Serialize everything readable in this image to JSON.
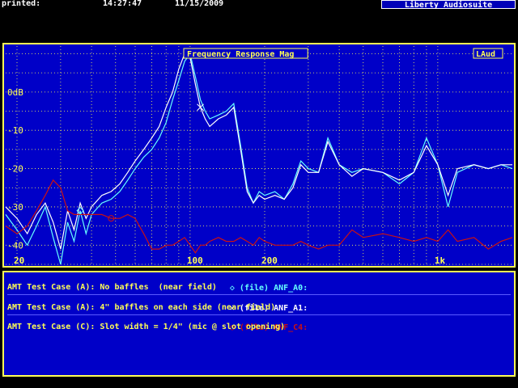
{
  "header": {
    "printed_label": "printed:",
    "time": "14:27:47",
    "date": "11/15/2009",
    "brand": "Liberty Audiosuite"
  },
  "chart_data": {
    "type": "line",
    "title": "Frequency Response Mag",
    "corner_label": "LAud",
    "xscale": "log",
    "xlim": [
      18,
      2000
    ],
    "ylim": [
      -45,
      12
    ],
    "x_tick_labels": [
      {
        "value": 20,
        "label": "20"
      },
      {
        "value": 100,
        "label": "100"
      },
      {
        "value": 200,
        "label": "200"
      },
      {
        "value": 1000,
        "label": "1k"
      }
    ],
    "y_tick_labels": [
      {
        "value": 0,
        "label": "0dB"
      },
      {
        "value": -10,
        "label": "-10"
      },
      {
        "value": -20,
        "label": "-20"
      },
      {
        "value": -30,
        "label": "-30"
      },
      {
        "value": -40,
        "label": "-40"
      }
    ],
    "grid": true,
    "series": [
      {
        "name": "(file) ANF_A0:",
        "color": "#66ffff",
        "marker": "diamond",
        "x": [
          18,
          20,
          22,
          24,
          26,
          28,
          30,
          32,
          34,
          36,
          38,
          40,
          44,
          48,
          52,
          56,
          60,
          65,
          70,
          75,
          80,
          85,
          90,
          95,
          100,
          105,
          110,
          115,
          120,
          130,
          140,
          150,
          160,
          170,
          180,
          190,
          200,
          220,
          240,
          260,
          280,
          300,
          330,
          360,
          400,
          450,
          500,
          600,
          700,
          800,
          900,
          1000,
          1100,
          1200,
          1400,
          1600,
          1800,
          2000
        ],
        "y": [
          -32,
          -36,
          -40,
          -35,
          -30,
          -38,
          -45,
          -34,
          -39,
          -31,
          -37,
          -32,
          -29,
          -28,
          -26,
          -23,
          -20,
          -17,
          -15,
          -12,
          -8,
          -2,
          3,
          8,
          10,
          4,
          -2,
          -5,
          -7,
          -6,
          -5,
          -3,
          -14,
          -25,
          -29,
          -26,
          -27,
          -26,
          -28,
          -24,
          -18,
          -20,
          -21,
          -12,
          -19,
          -21,
          -20,
          -21,
          -24,
          -21,
          -12,
          -19,
          -30,
          -21,
          -19,
          -20,
          -19,
          -20
        ]
      },
      {
        "name": "(file) ANF_A1:",
        "color": "#ffffff",
        "marker": "x",
        "x": [
          18,
          20,
          22,
          24,
          26,
          28,
          30,
          32,
          34,
          36,
          38,
          40,
          44,
          48,
          52,
          56,
          60,
          65,
          70,
          75,
          80,
          85,
          90,
          95,
          100,
          105,
          110,
          115,
          120,
          130,
          140,
          150,
          160,
          170,
          180,
          190,
          200,
          220,
          240,
          260,
          280,
          300,
          330,
          360,
          400,
          450,
          500,
          600,
          700,
          800,
          900,
          1000,
          1100,
          1200,
          1400,
          1600,
          1800,
          2000
        ],
        "y": [
          -30,
          -33,
          -37,
          -32,
          -29,
          -34,
          -41,
          -31,
          -36,
          -29,
          -33,
          -30,
          -27,
          -26,
          -24,
          -21,
          -18,
          -15,
          -12,
          -9,
          -4,
          0,
          6,
          10,
          9,
          2,
          -4,
          -7,
          -9,
          -7,
          -6,
          -4,
          -15,
          -26,
          -29,
          -27,
          -28,
          -27,
          -28,
          -25,
          -19,
          -21,
          -21,
          -13,
          -19,
          -22,
          -20,
          -21,
          -23,
          -21,
          -14,
          -19,
          -27,
          -20,
          -19,
          -20,
          -19,
          -19
        ]
      },
      {
        "name": "(file) ANF_C4:",
        "color": "#cc1111",
        "marker": "circle",
        "x": [
          18,
          20,
          22,
          24,
          26,
          28,
          30,
          32,
          34,
          36,
          38,
          40,
          44,
          48,
          52,
          56,
          60,
          65,
          70,
          75,
          80,
          85,
          90,
          95,
          100,
          105,
          110,
          115,
          120,
          130,
          140,
          150,
          160,
          170,
          180,
          190,
          200,
          220,
          240,
          260,
          280,
          300,
          330,
          360,
          400,
          450,
          500,
          600,
          700,
          800,
          900,
          1000,
          1100,
          1200,
          1400,
          1600,
          1800,
          2000
        ],
        "y": [
          -35,
          -37,
          -35,
          -31,
          -27,
          -23,
          -25,
          -31,
          -32,
          -32,
          -32,
          -32,
          -32,
          -33,
          -33,
          -32,
          -33,
          -37,
          -41,
          -41,
          -40,
          -40,
          -39,
          -38,
          -40,
          -42,
          -40,
          -40,
          -39,
          -38,
          -39,
          -39,
          -38,
          -39,
          -40,
          -38,
          -39,
          -40,
          -40,
          -40,
          -39,
          -40,
          -41,
          -40,
          -40,
          -36,
          -38,
          -37,
          -38,
          -39,
          -38,
          -39,
          -36,
          -39,
          -38,
          -41,
          -39,
          -38
        ]
      }
    ]
  },
  "legend": {
    "entries": [
      {
        "symbol": "◇",
        "name": "(file) ANF_A0:",
        "color": "#66ffff",
        "description": "AMT Test Case (A): No baffles  (near field)"
      },
      {
        "symbol": "✕",
        "name": "(file) ANF_A1:",
        "color": "#ffffff",
        "description": "AMT Test Case (A): 4\" baffles on each side (near field)"
      },
      {
        "symbol": "○",
        "name": "(file) ANF_C4:",
        "color": "#cc1111",
        "description": "AMT Test Case (C): Slot width = 1/4\" (mic @ slot opening)"
      }
    ]
  }
}
